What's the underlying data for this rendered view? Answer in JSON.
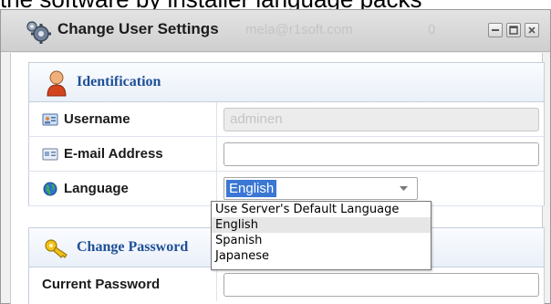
{
  "caption_fragment": "the software by installer language packs",
  "window": {
    "title": "Change User Settings",
    "ghost_text": "mela@r1soft.com",
    "ghost_number": "0"
  },
  "identification": {
    "title": "Identification",
    "username_label": "Username",
    "username_value": "adminen",
    "email_label": "E-mail Address",
    "email_value": "",
    "language_label": "Language",
    "language_value": "English"
  },
  "language_options": [
    "Use Server's Default Language",
    "English",
    "Spanish",
    "Japanese"
  ],
  "change_password": {
    "title": "Change Password",
    "current_password_label": "Current Password"
  },
  "colors": {
    "section_title": "#1e4f96",
    "selected_value_bg": "#3b77d4"
  }
}
